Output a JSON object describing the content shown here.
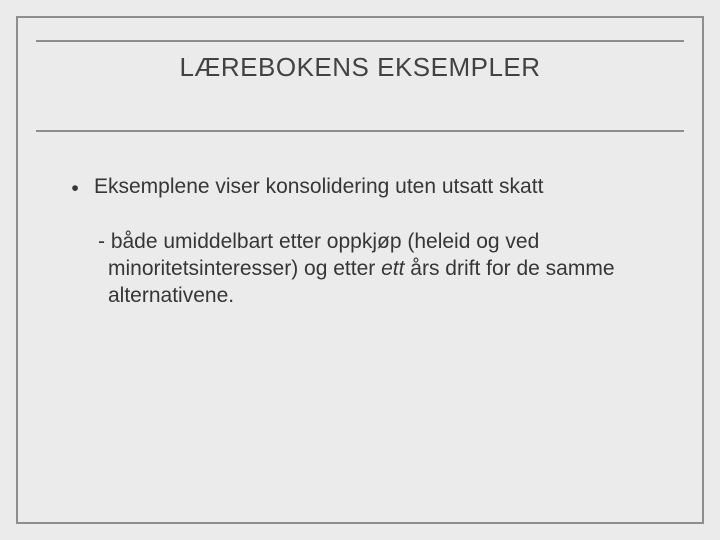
{
  "title": "LÆREBOKENS EKSEMPLER",
  "bullet": "Eksemplene viser konsolidering uten utsatt skatt",
  "sub_prefix": "- både umiddelbart etter oppkjøp (heleid og ved minoritetsinteresser) og etter ",
  "sub_italic": "ett",
  "sub_suffix": " års drift for de samme alternativene."
}
